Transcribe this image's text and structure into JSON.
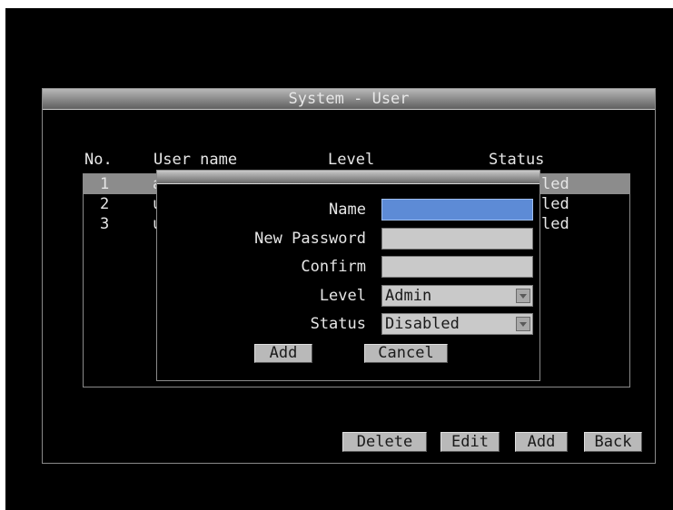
{
  "window": {
    "title": "System - User"
  },
  "table": {
    "headers": {
      "no": "No.",
      "user_name": "User name",
      "level": "Level",
      "status": "Status"
    },
    "rows": [
      {
        "no": "1",
        "name_fragment": "a",
        "status_fragment": "led"
      },
      {
        "no": "2",
        "name_fragment": "u",
        "status_fragment": "led"
      },
      {
        "no": "3",
        "name_fragment": "u",
        "status_fragment": "led"
      }
    ]
  },
  "dialog": {
    "name_label": "Name",
    "name_value": "",
    "new_password_label": "New Password",
    "confirm_label": "Confirm",
    "level_label": "Level",
    "level_value": "Admin",
    "status_label": "Status",
    "status_value": "Disabled",
    "add_button": "Add",
    "cancel_button": "Cancel"
  },
  "buttons": {
    "delete": "Delete",
    "edit": "Edit",
    "add": "Add",
    "back": "Back"
  },
  "colors": {
    "active_field": "#5d8bd6",
    "selected_row": "#8c8c8c",
    "background": "#000000"
  }
}
